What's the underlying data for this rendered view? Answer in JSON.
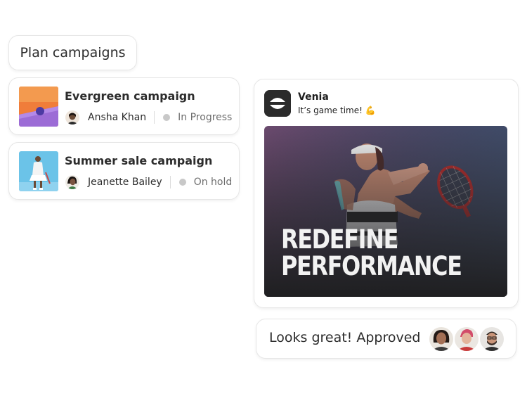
{
  "header": {
    "title": "Plan campaigns"
  },
  "campaigns": [
    {
      "name": "Evergreen campaign",
      "owner": "Ansha Khan",
      "status": "In Progress",
      "thumbnail_icon": "orange-ball-on-steps-image",
      "status_color": "#c8c8c8"
    },
    {
      "name": "Summer sale campaign",
      "owner": "Jeanette Bailey",
      "status": "On hold",
      "thumbnail_icon": "tennis-player-in-white-image",
      "status_color": "#c8c8c8"
    }
  ],
  "post": {
    "brand": "Venia",
    "message": "It’s game time! 💪",
    "brand_logo_icon": "venia-logo-icon",
    "image_icon": "tennis-player-photo",
    "headline_line1": "REDEFINE",
    "headline_line2": "PERFORMANCE"
  },
  "comment": {
    "text": "Looks great! Approved",
    "approvers_icon": "approver-avatars"
  },
  "colors": {
    "card_border": "#e6e6e6",
    "text": "#2c2c2c",
    "status_dot": "#c8c8c8",
    "brand_logo_bg": "#2b2b2b"
  }
}
